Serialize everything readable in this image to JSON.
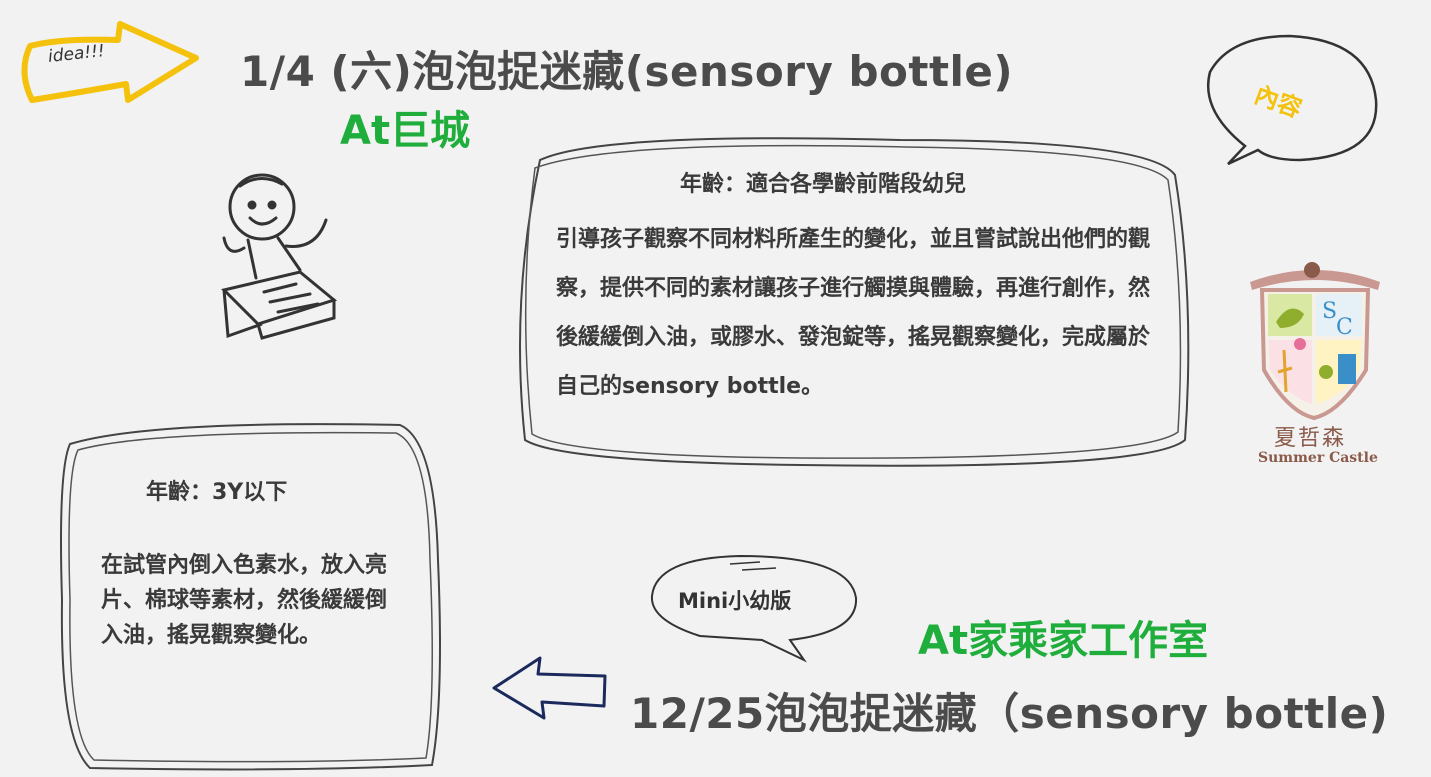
{
  "header": {
    "title": "1/4 (六)泡泡捉迷藏(sensory bottle)",
    "location": "At巨城",
    "idea_tag": "idea!!!",
    "content_bubble": "內容"
  },
  "card_main": {
    "age": "年齡：適合各學齡前階段幼兒",
    "description": "引導孩子觀察不同材料所產生的變化，並且嘗試說出他們的觀察，提供不同的素材讓孩子進行觸摸與體驗，再進行創作，然後緩緩倒入油，或膠水、發泡錠等，搖晃觀察變化，完成屬於自己的sensory bottle。"
  },
  "card_mini": {
    "age": "年齡：3Y以下",
    "description": "在試管內倒入色素水，放入亮片、棉球等素材，然後緩緩倒入油，搖晃觀察變化。"
  },
  "mini_bubble": "Mini小幼版",
  "footer": {
    "location": "At家乘家工作室",
    "title": "12/25泡泡捉迷藏（sensory bottle)"
  },
  "logo": {
    "letters": "SC",
    "name_cn": "夏哲森",
    "name_en": "Summer Castle"
  },
  "colors": {
    "background": "#f2f2f2",
    "accent_green": "#1fae3c",
    "accent_yellow": "#f4c20d",
    "text_dark": "#4b4b4b",
    "arrow_navy": "#1b2a5c",
    "logo_brown": "#8a5a4a"
  }
}
